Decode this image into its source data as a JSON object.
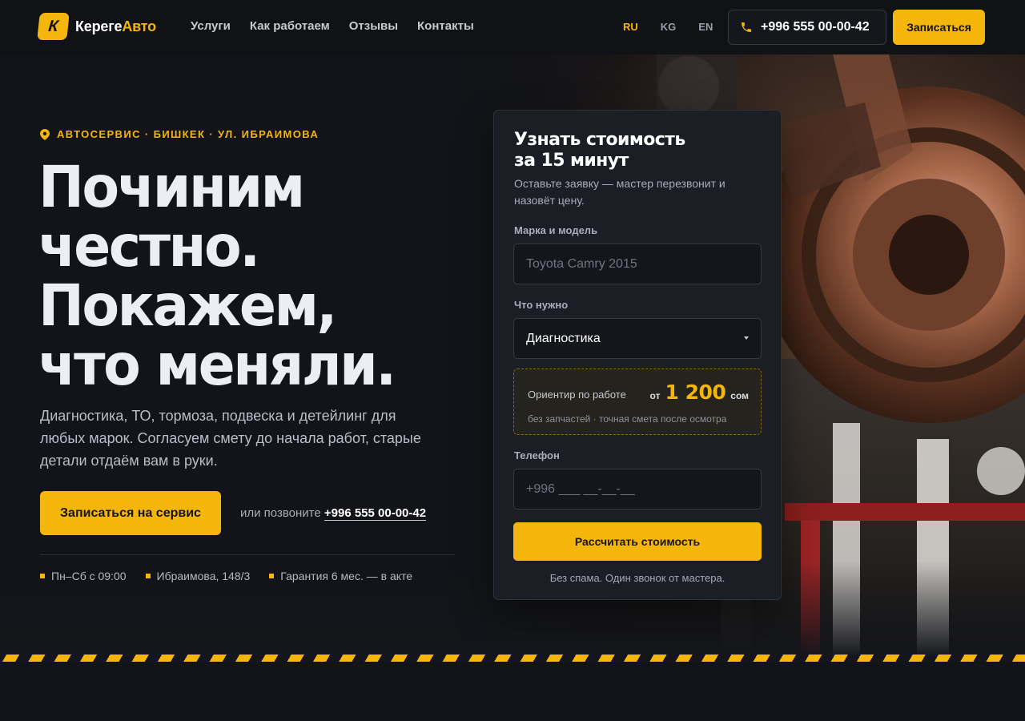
{
  "brand": {
    "logo_letter": "К",
    "name_part1": "Кереге",
    "name_part2": "Авто",
    "accent_color": "#f5b60b"
  },
  "nav": {
    "items": [
      {
        "label": "Услуги"
      },
      {
        "label": "Как работаем"
      },
      {
        "label": "Отзывы"
      },
      {
        "label": "Контакты"
      }
    ]
  },
  "languages": {
    "items": [
      {
        "label": "RU",
        "active": true
      },
      {
        "label": "KG",
        "active": false
      },
      {
        "label": "EN",
        "active": false
      }
    ]
  },
  "header": {
    "phone": "+996 555 00-00-42",
    "signup_label": "Записаться"
  },
  "hero": {
    "eyebrow": "АВТОСЕРВИС · БИШКЕК · УЛ. ИБРАИМОВА",
    "headline_lines": [
      "Починим",
      "честно.",
      "Покажем,",
      "что меняли."
    ],
    "lead": "Диагностика, ТО, тормоза, подвеска и детейлинг для любых марок. Согласуем смету до начала работ, старые детали отдаём вам в руки.",
    "cta_label": "Записаться на сервис",
    "or_call_text": "или позвоните",
    "or_call_phone": "+996 555 00-00-42",
    "facts": [
      "Пн–Сб с 09:00",
      "Ибраимова, 148/3",
      "Гарантия 6 мес. — в акте"
    ]
  },
  "form": {
    "title_lines": [
      "Узнать стоимость",
      "за 15 минут"
    ],
    "subtitle": "Оставьте заявку — мастер перезвонит и назовёт цену.",
    "car_label": "Марка и модель",
    "car_placeholder": "Toyota Camry 2015",
    "service_label": "Что нужно",
    "service_value": "Диагностика",
    "estimate": {
      "label": "Ориентир по работе",
      "from": "от",
      "price": "1 200",
      "currency": "сом",
      "note": "без запчастей · точная смета после осмотра"
    },
    "phone_label": "Телефон",
    "phone_placeholder": "+996 ___ __-__-__",
    "submit_label": "Рассчитать стоимость",
    "no_spam": "Без спама. Один звонок от мастера."
  }
}
